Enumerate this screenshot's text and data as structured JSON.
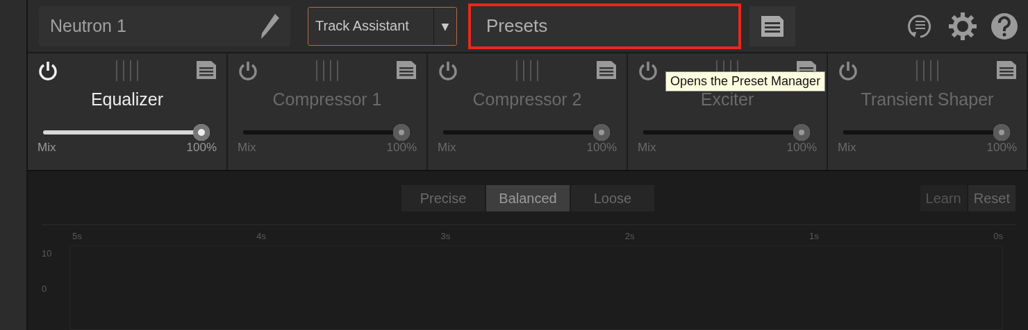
{
  "header": {
    "name_field": {
      "value": "Neutron 1"
    },
    "assistant_button": {
      "label": "Track Assistant",
      "caret": "▼"
    },
    "presets_field": {
      "value": "Presets",
      "highlighted": true
    },
    "tooltip": {
      "text": "Opens the Preset Manager"
    }
  },
  "modules": [
    {
      "name": "Equalizer",
      "enabled": true,
      "level": 1,
      "mix_label": "Mix",
      "reading": "100%"
    },
    {
      "name": "Compressor 1",
      "enabled": false,
      "level": 1,
      "mix_label": "Mix",
      "reading": "100%"
    },
    {
      "name": "Compressor 2",
      "enabled": false,
      "level": 1,
      "mix_label": "Mix",
      "reading": "100%"
    },
    {
      "name": "Exciter",
      "enabled": false,
      "level": 1,
      "mix_label": "Mix",
      "reading": "100%"
    },
    {
      "name": "Transient Shaper",
      "enabled": false,
      "level": 1,
      "mix_label": "Mix",
      "reading": "100%"
    }
  ],
  "detection_modes": [
    {
      "label": "Precise",
      "selected": false
    },
    {
      "label": "Balanced",
      "selected": true
    },
    {
      "label": "Loose",
      "selected": false
    }
  ],
  "actions": [
    {
      "label": "Learn",
      "disabled": true
    },
    {
      "label": "Reset",
      "disabled": false
    }
  ],
  "graph": {
    "time_labels": [
      "5s",
      "4s",
      "3s",
      "2s",
      "1s",
      "0s"
    ],
    "level_labels": [
      "10",
      "0"
    ]
  }
}
